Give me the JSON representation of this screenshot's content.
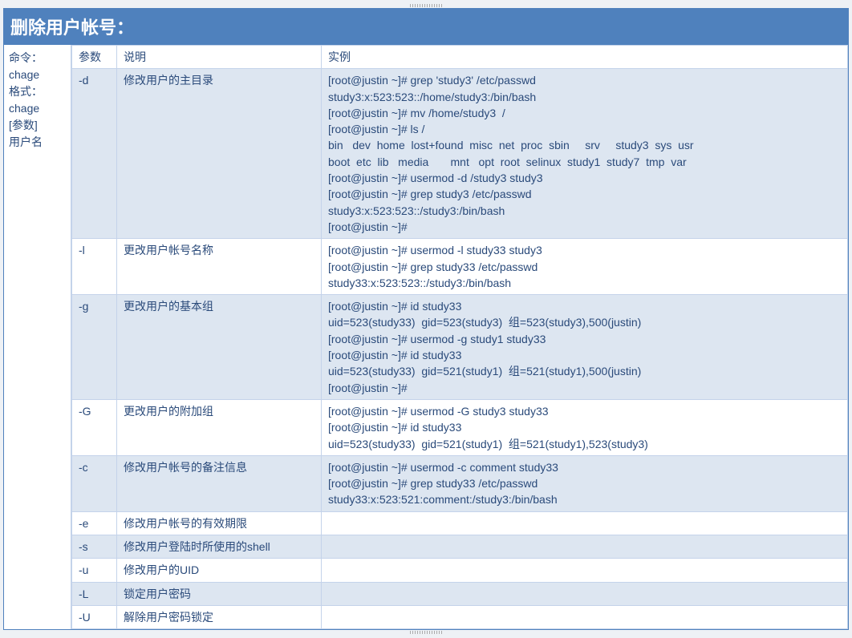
{
  "title": "删除用户帐号：",
  "sidebar": [
    "命令：",
    "chage",
    "格式：",
    "chage",
    "[参数]",
    "用户名"
  ],
  "headers": {
    "param": "参数",
    "desc": "说明",
    "example": "实例"
  },
  "rows": [
    {
      "alt": true,
      "param": "-d",
      "desc": "修改用户的主目录",
      "example": "[root@justin ~]# grep 'study3' /etc/passwd\nstudy3:x:523:523::/home/study3:/bin/bash\n[root@justin ~]# mv /home/study3  /\n[root@justin ~]# ls /\nbin   dev  home  lost+found  misc  net  proc  sbin     srv     study3  sys  usr\nboot  etc  lib   media       mnt   opt  root  selinux  study1  study7  tmp  var\n[root@justin ~]# usermod -d /study3 study3\n[root@justin ~]# grep study3 /etc/passwd\nstudy3:x:523:523::/study3:/bin/bash\n[root@justin ~]#"
    },
    {
      "alt": false,
      "param": "-l",
      "desc": "更改用户帐号名称",
      "example": "[root@justin ~]# usermod -l study33 study3\n[root@justin ~]# grep study33 /etc/passwd\nstudy33:x:523:523::/study3:/bin/bash"
    },
    {
      "alt": true,
      "param": "-g",
      "desc": "更改用户的基本组",
      "example": "[root@justin ~]# id study33\nuid=523(study33)  gid=523(study3)  组=523(study3),500(justin)\n[root@justin ~]# usermod -g study1 study33\n[root@justin ~]# id study33\nuid=523(study33)  gid=521(study1)  组=521(study1),500(justin)\n[root@justin ~]#"
    },
    {
      "alt": false,
      "param": "-G",
      "desc": "更改用户的附加组",
      "example": "[root@justin ~]# usermod -G study3 study33\n[root@justin ~]# id study33\nuid=523(study33)  gid=521(study1)  组=521(study1),523(study3)"
    },
    {
      "alt": true,
      "param": "-c",
      "desc": "修改用户帐号的备注信息",
      "example": "[root@justin ~]# usermod -c comment study33\n[root@justin ~]# grep study33 /etc/passwd\nstudy33:x:523:521:comment:/study3:/bin/bash"
    },
    {
      "alt": false,
      "param": "-e",
      "desc": "修改用户帐号的有效期限",
      "example": ""
    },
    {
      "alt": true,
      "param": "-s",
      "desc": "修改用户登陆时所使用的shell",
      "example": ""
    },
    {
      "alt": false,
      "param": "-u",
      "desc": "修改用户的UID",
      "example": ""
    },
    {
      "alt": true,
      "param": "-L",
      "desc": "锁定用户密码",
      "example": ""
    },
    {
      "alt": false,
      "param": "-U",
      "desc": "解除用户密码锁定",
      "example": ""
    }
  ]
}
